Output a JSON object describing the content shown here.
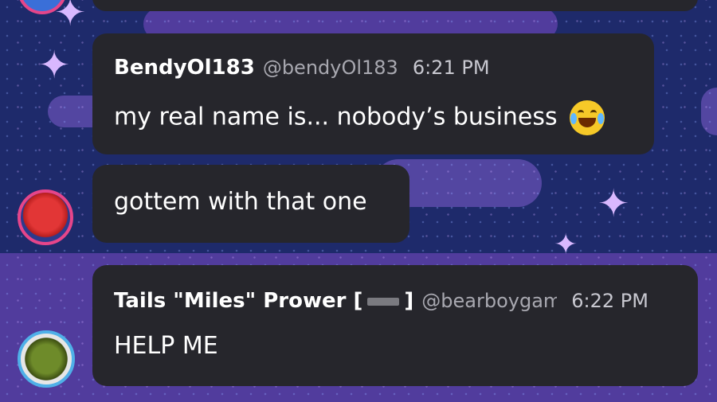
{
  "messages": [
    {
      "display_name": "BendyOl183",
      "handle": "@bendyOl183",
      "time": "6:21 PM",
      "text": "my real name is... nobody’s business",
      "emoji": "face-with-tears-of-joy"
    },
    {
      "text": "gottem with that one"
    },
    {
      "display_name_prefix": "Tails \"Miles\" Prower [",
      "display_name_suffix": "]",
      "handle": "@bearboygame",
      "time": "6:22 PM",
      "text": "HELP ME"
    }
  ],
  "colors": {
    "bubble": "#26262c",
    "background": "#1e2a6b",
    "accent_purple": "#5b3fa6"
  }
}
